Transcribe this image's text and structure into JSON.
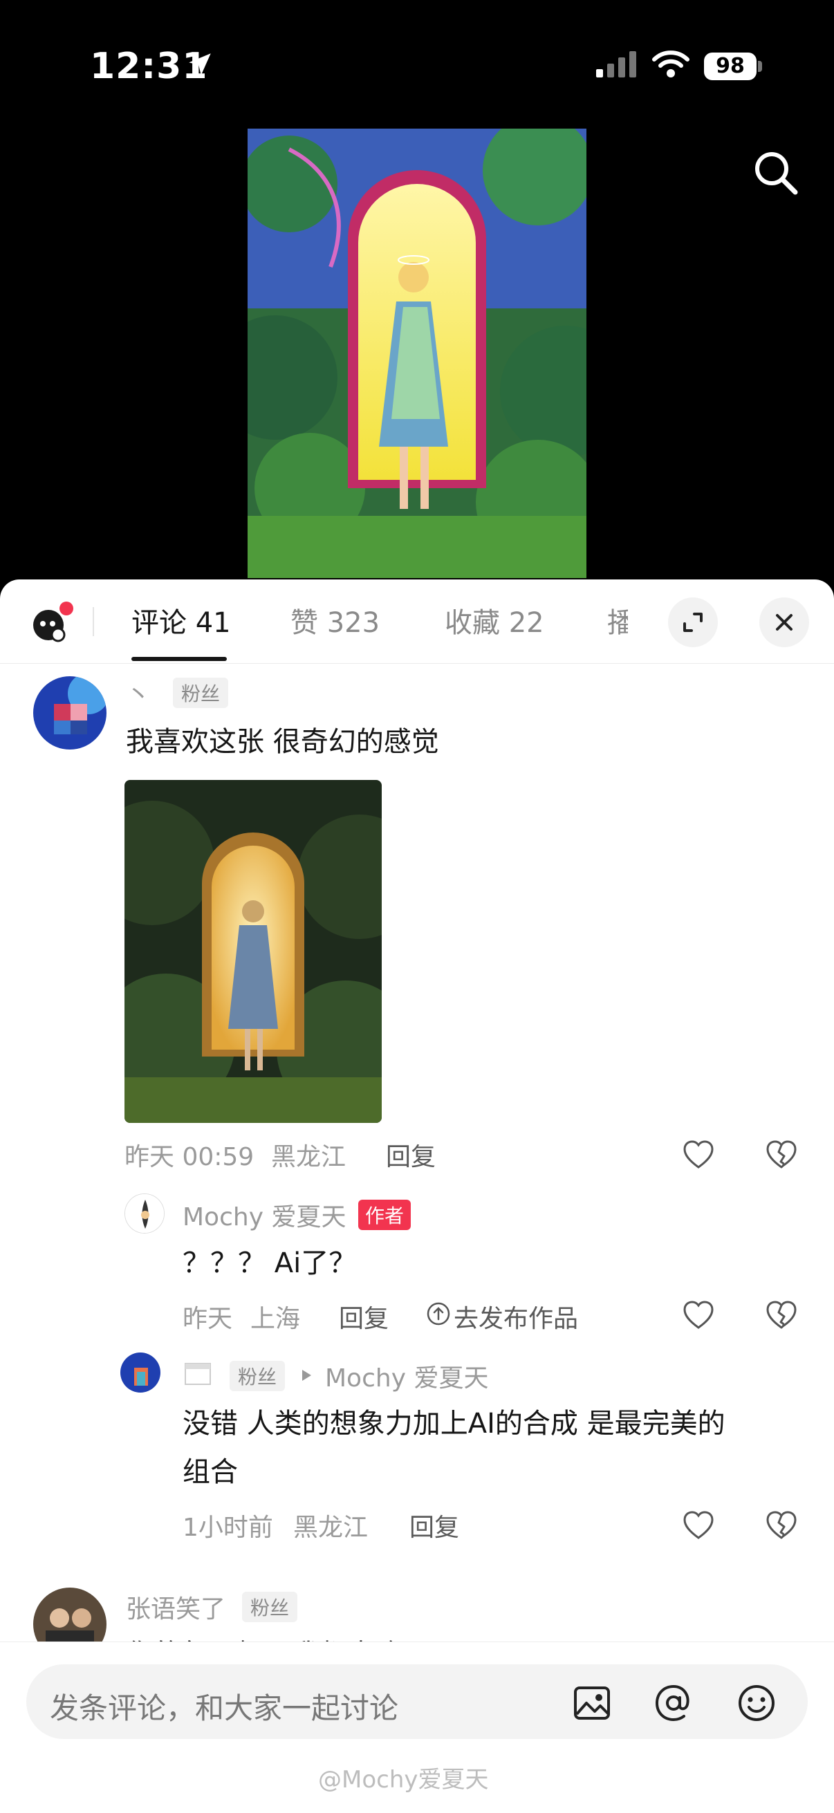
{
  "status_bar": {
    "time": "12:31",
    "battery": "98"
  },
  "tabs": {
    "comments": "评论 41",
    "likes": "赞 323",
    "favorites": "收藏 22",
    "more_cut": "播"
  },
  "comments": [
    {
      "name": "丶",
      "badge": "粉丝",
      "text": "我喜欢这张 很奇幻的感觉",
      "time": "昨天 00:59",
      "location": "黑龙江",
      "reply_label": "回复",
      "replies": [
        {
          "name": "Mochy 爱夏天",
          "badge": "作者",
          "text": "？？？ Ai了？",
          "time": "昨天",
          "location": "上海",
          "reply_label": "回复",
          "action": "去发布作品"
        },
        {
          "name": "丶",
          "badge": "粉丝",
          "reply_to": "Mochy 爱夏天",
          "text_line1": "没错 人类的想象力加上AI的合成 是最完美的",
          "text_line2": "组合",
          "time": "1小时前",
          "location": "黑龙江",
          "reply_label": "回复"
        }
      ]
    },
    {
      "name": "张语笑了",
      "badge": "粉丝",
      "text_partial": "你的每一幅画我都喜欢"
    }
  ],
  "input": {
    "placeholder": "发条评论，和大家一起讨论"
  },
  "watermark": "@Mochy爱夏天",
  "colors": {
    "accent_red": "#f2344f",
    "text_dark": "#161616",
    "text_grey": "#9a9a9a"
  }
}
